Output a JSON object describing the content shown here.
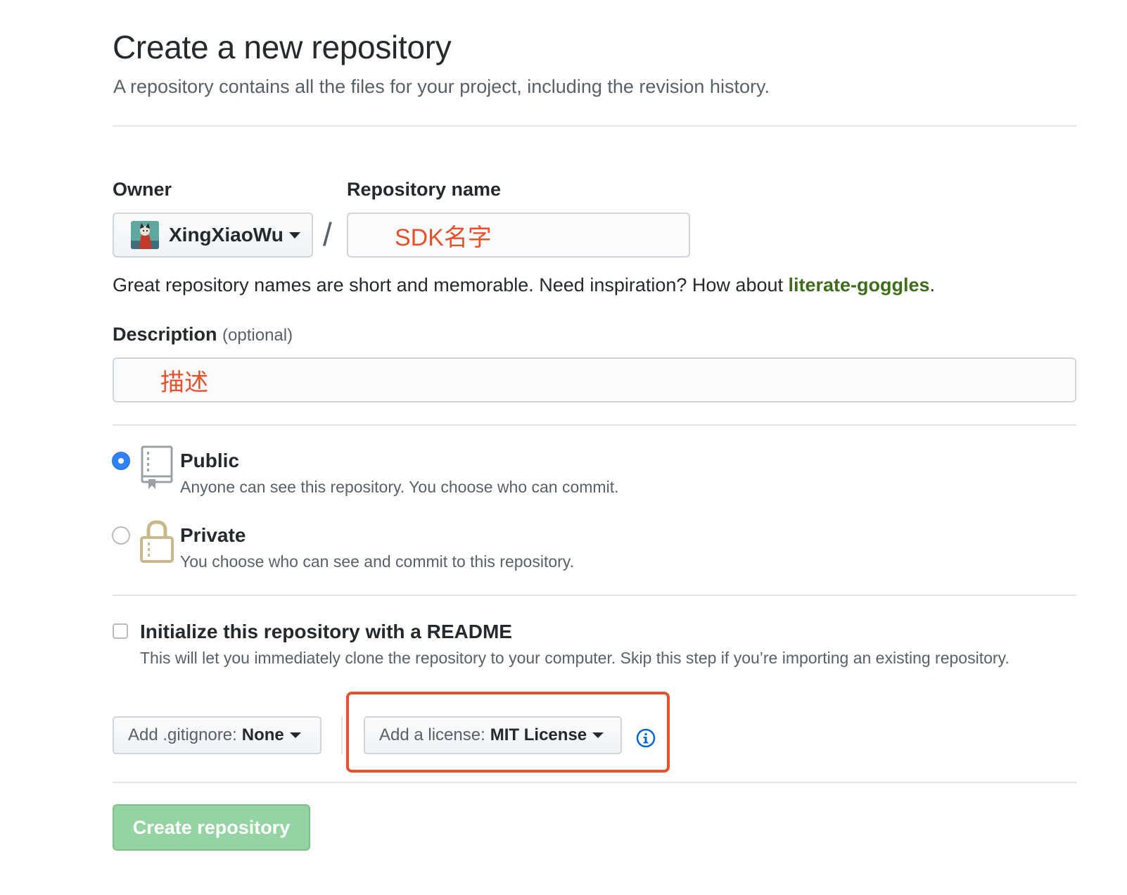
{
  "header": {
    "title": "Create a new repository",
    "subtitle": "A repository contains all the files for your project, including the revision history."
  },
  "owner": {
    "label": "Owner",
    "value": "XingXiaoWu"
  },
  "repo_name": {
    "label": "Repository name",
    "separator": "/",
    "value": "SDK名字"
  },
  "name_hint": {
    "text": "Great repository names are short and memorable. Need inspiration? How about ",
    "suggestion": "literate-goggles",
    "suffix": "."
  },
  "description": {
    "label": "Description",
    "optional": "(optional)",
    "value": "描述"
  },
  "visibility": {
    "selected": "public",
    "public": {
      "title": "Public",
      "desc": "Anyone can see this repository. You choose who can commit."
    },
    "private": {
      "title": "Private",
      "desc": "You choose who can see and commit to this repository."
    }
  },
  "readme": {
    "checked": false,
    "title": "Initialize this repository with a README",
    "desc": "This will let you immediately clone the repository to your computer. Skip this step if you’re importing an existing repository."
  },
  "gitignore": {
    "prefix": "Add .gitignore:",
    "value": "None"
  },
  "license": {
    "prefix": "Add a license:",
    "value": "MIT License"
  },
  "submit": {
    "label": "Create repository",
    "enabled": false
  },
  "colors": {
    "annotation": "#e8502a",
    "link_green": "#3f6e1b",
    "radio_blue": "#2f81f7",
    "button_green_disabled": "#94d3a2",
    "info_blue": "#0366d6"
  },
  "icons": [
    "caret-down-icon",
    "repo-icon",
    "lock-icon",
    "info-icon"
  ]
}
